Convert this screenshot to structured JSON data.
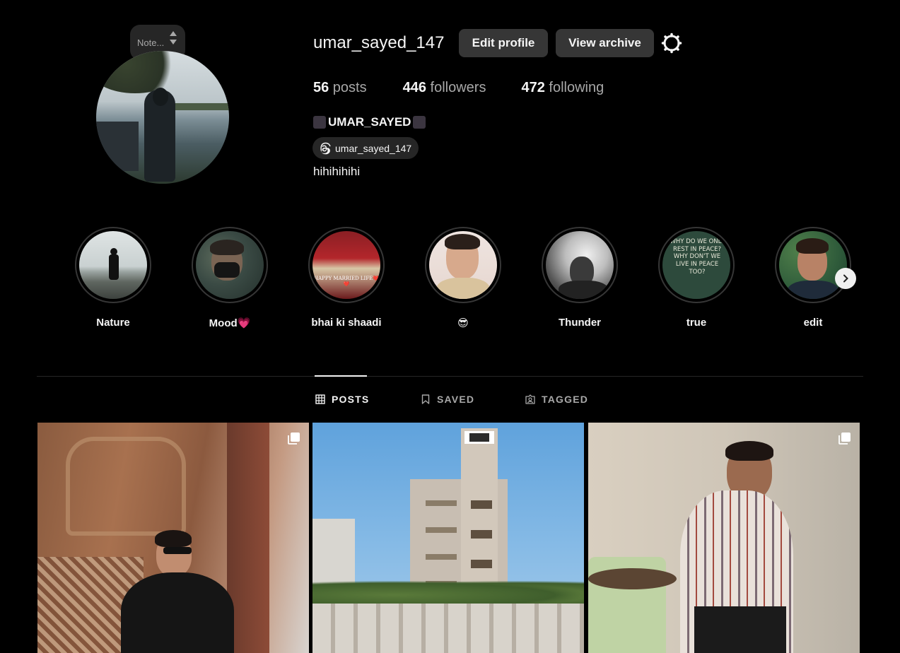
{
  "note": {
    "text": "Note..."
  },
  "profile": {
    "username": "umar_sayed_147",
    "edit_label": "Edit profile",
    "archive_label": "View archive",
    "posts_count": "56",
    "posts_label": " posts",
    "followers_count": "446",
    "followers_label": " followers",
    "following_count": "472",
    "following_label": " following",
    "full_name": "UMAR_SAYED",
    "threads_handle": "umar_sayed_147",
    "bio": "hihihihihi"
  },
  "highlights": [
    {
      "label": "Nature"
    },
    {
      "label": "Mood💗"
    },
    {
      "label": "bhai ki shaadi",
      "caption": "HAPPY MARRIED LIFE❤️❤️"
    },
    {
      "label": "😎"
    },
    {
      "label": "Thunder"
    },
    {
      "label": "true",
      "caption": "WHY DO WE ONLY REST IN PEACE? WHY DON'T WE LIVE IN PEACE TOO?"
    },
    {
      "label": "edit"
    }
  ],
  "tabs": [
    {
      "label": "POSTS",
      "icon": "grid-icon",
      "active": true
    },
    {
      "label": "SAVED",
      "icon": "bookmark-icon"
    },
    {
      "label": "TAGGED",
      "icon": "tagged-icon"
    }
  ],
  "colors": {
    "background": "#000000",
    "button": "#363636",
    "secondary_text": "#a8a8a8"
  }
}
